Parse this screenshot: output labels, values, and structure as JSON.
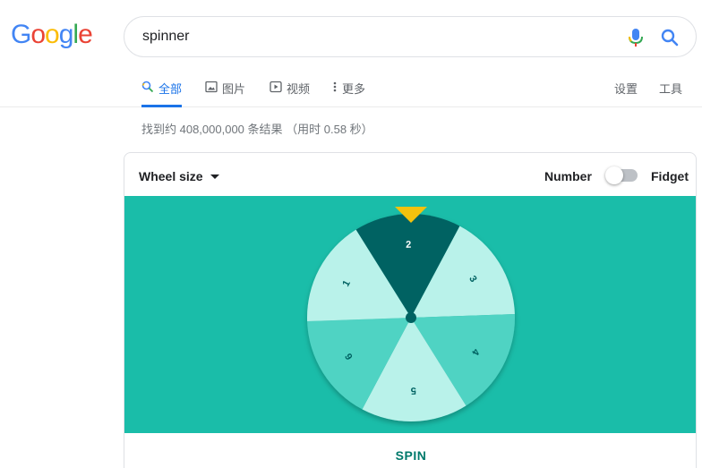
{
  "logo": {
    "letters": [
      "G",
      "o",
      "o",
      "g",
      "l",
      "e"
    ],
    "colors": [
      "#4285f4",
      "#ea4335",
      "#fbbc05",
      "#4285f4",
      "#34a853",
      "#ea4335"
    ]
  },
  "search": {
    "query": "spinner"
  },
  "icons": {
    "mic": "mic-icon",
    "search": "search-icon",
    "images": "image-icon",
    "videos": "play-icon",
    "more": "more-vert-icon"
  },
  "tabs": [
    {
      "label": "全部",
      "active": true
    },
    {
      "label": "图片",
      "active": false
    },
    {
      "label": "视频",
      "active": false
    },
    {
      "label": "更多",
      "active": false
    }
  ],
  "tools": {
    "settings": "设置",
    "tools": "工具"
  },
  "result_stats": "找到约 408,000,000 条结果 （用时 0.58 秒）",
  "spinner": {
    "wheel_size_label": "Wheel size",
    "mode_number": "Number",
    "mode_fidget": "Fidget",
    "mode_toggle_on": false,
    "segments": [
      "2",
      "3",
      "4",
      "5",
      "6",
      "1"
    ],
    "segment_colors": [
      "#006262",
      "#b9f2ea",
      "#4fd3c3",
      "#b9f2ea",
      "#4fd3c3",
      "#b9f2ea"
    ],
    "spin_label": "SPIN",
    "colors": {
      "stage": "#1abda9",
      "pointer": "#f4c20d",
      "accent": "#00796b"
    }
  }
}
